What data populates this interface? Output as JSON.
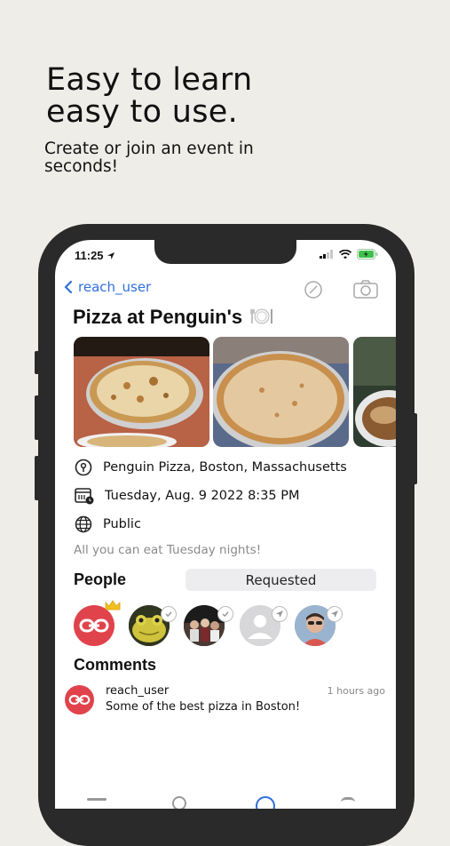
{
  "hero": {
    "title_line1": "Easy to learn",
    "title_line2": "easy to use.",
    "subtitle": "Create or join an event in seconds!"
  },
  "status_bar": {
    "time": "11:25"
  },
  "nav": {
    "back_label": "reach_user"
  },
  "event": {
    "title": "Pizza at Penguin's",
    "title_icon": "plate-cutlery-icon",
    "location": "Penguin Pizza, Boston, Massachusetts",
    "datetime": "Tuesday, Aug. 9 2022 8:35 PM",
    "visibility": "Public",
    "description": "All you can eat Tuesday nights!"
  },
  "people": {
    "label": "People",
    "status_button": "Requested",
    "avatars": [
      {
        "name": "host-avatar",
        "badge": "crown-icon"
      },
      {
        "name": "guest-avatar-1",
        "badge": "check-icon"
      },
      {
        "name": "guest-avatar-2",
        "badge": "check-icon"
      },
      {
        "name": "guest-avatar-3",
        "badge": "send-icon"
      },
      {
        "name": "guest-avatar-4",
        "badge": "send-icon"
      }
    ]
  },
  "comments": {
    "label": "Comments",
    "items": [
      {
        "user": "reach_user",
        "time": "1 hours ago",
        "text": "Some of the best pizza in Boston!"
      }
    ]
  },
  "colors": {
    "accent": "#2f6fdc",
    "brand_red": "#e0434b",
    "background": "#efede8"
  }
}
